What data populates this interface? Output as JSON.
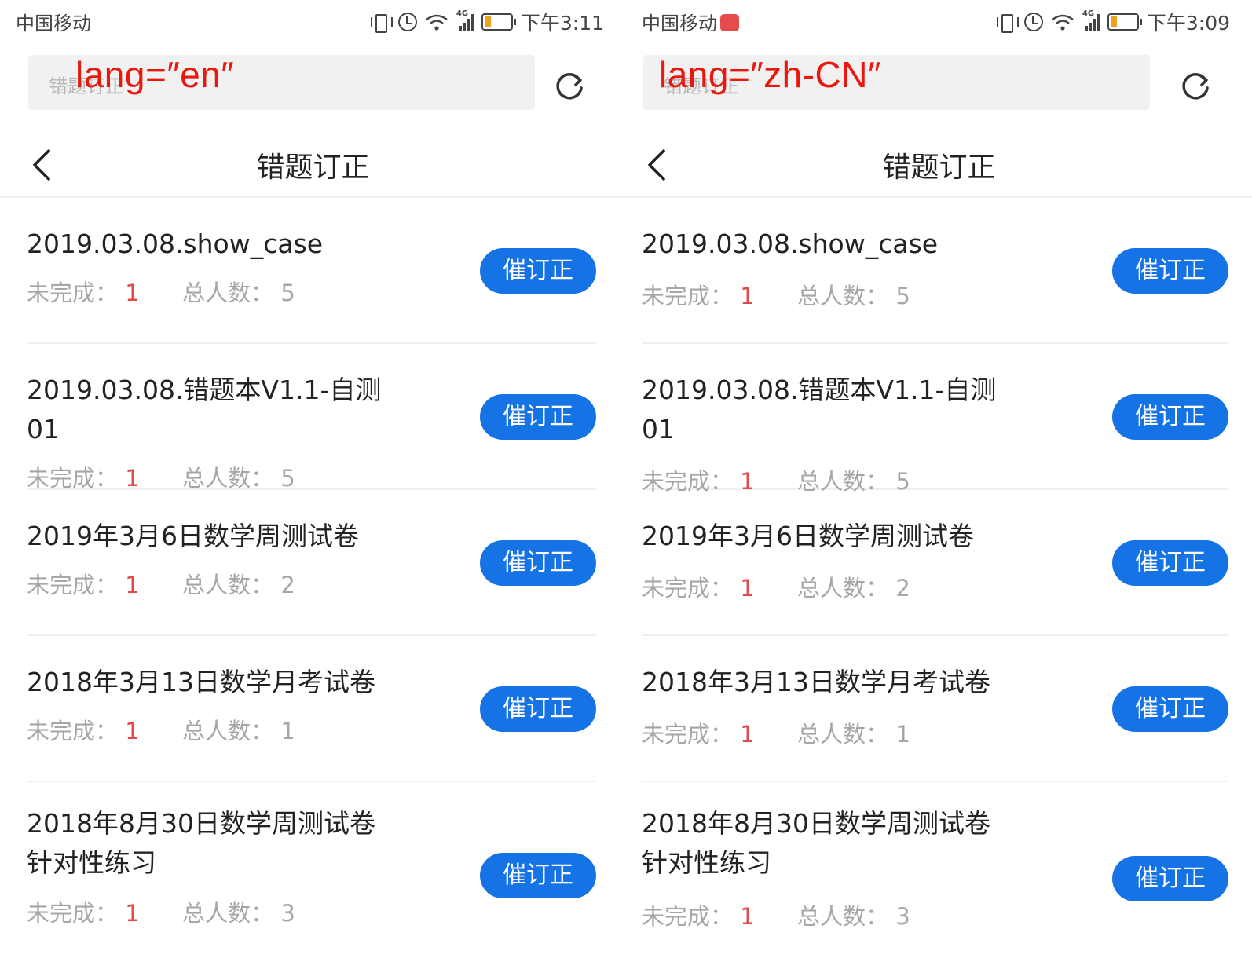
{
  "screens": [
    {
      "status": {
        "carrier": "中国移动",
        "time": "下午3:11",
        "network": "4G"
      },
      "search": {
        "placeholder": "错题订正",
        "overlay": "lang=″en″"
      },
      "header": {
        "title": "错题订正"
      },
      "items": [
        {
          "title": "2019.03.08.show_case",
          "incomplete_label": "未完成：",
          "incomplete": "1",
          "total_label": "总人数：",
          "total": "5",
          "button": "催订正"
        },
        {
          "title": "2019.03.08.错题本V1.1-自测01",
          "incomplete_label": "未完成：",
          "incomplete": "1",
          "total_label": "总人数：",
          "total": "5",
          "button": "催订正"
        },
        {
          "title": "2019年3月6日数学周测试卷",
          "incomplete_label": "未完成：",
          "incomplete": "1",
          "total_label": "总人数：",
          "total": "2",
          "button": "催订正"
        },
        {
          "title": "2018年3月13日数学月考试卷",
          "incomplete_label": "未完成：",
          "incomplete": "1",
          "total_label": "总人数：",
          "total": "1",
          "button": "催订正"
        },
        {
          "title": "2018年8月30日数学周测试卷针对性练习",
          "incomplete_label": "未完成：",
          "incomplete": "1",
          "total_label": "总人数：",
          "total": "3",
          "button": "催订正"
        }
      ]
    },
    {
      "status": {
        "carrier": "中国移动",
        "time": "下午3:09",
        "network": "4G"
      },
      "search": {
        "placeholder": "错题订正",
        "overlay": "lang=″zh-CN″"
      },
      "header": {
        "title": "错题订正"
      },
      "items": [
        {
          "title": "2019.03.08.show_case",
          "incomplete_label": "未完成：",
          "incomplete": "1",
          "total_label": "总人数：",
          "total": "5",
          "button": "催订正"
        },
        {
          "title": "2019.03.08.错题本V1.1-自测01",
          "incomplete_label": "未完成：",
          "incomplete": "1",
          "total_label": "总人数：",
          "total": "5",
          "button": "催订正"
        },
        {
          "title": "2019年3月6日数学周测试卷",
          "incomplete_label": "未完成：",
          "incomplete": "1",
          "total_label": "总人数：",
          "total": "2",
          "button": "催订正"
        },
        {
          "title": "2018年3月13日数学月考试卷",
          "incomplete_label": "未完成：",
          "incomplete": "1",
          "total_label": "总人数：",
          "total": "1",
          "button": "催订正"
        },
        {
          "title": "2018年8月30日数学周测试卷针对性练习",
          "incomplete_label": "未完成：",
          "incomplete": "1",
          "total_label": "总人数：",
          "total": "3",
          "button": "催订正"
        }
      ]
    }
  ],
  "colors": {
    "accent": "#1673e6",
    "incomplete": "#e14a4a",
    "overlay": "#e8180e",
    "battery": "#f0a020",
    "carrier_badge": "#e54b4b"
  }
}
